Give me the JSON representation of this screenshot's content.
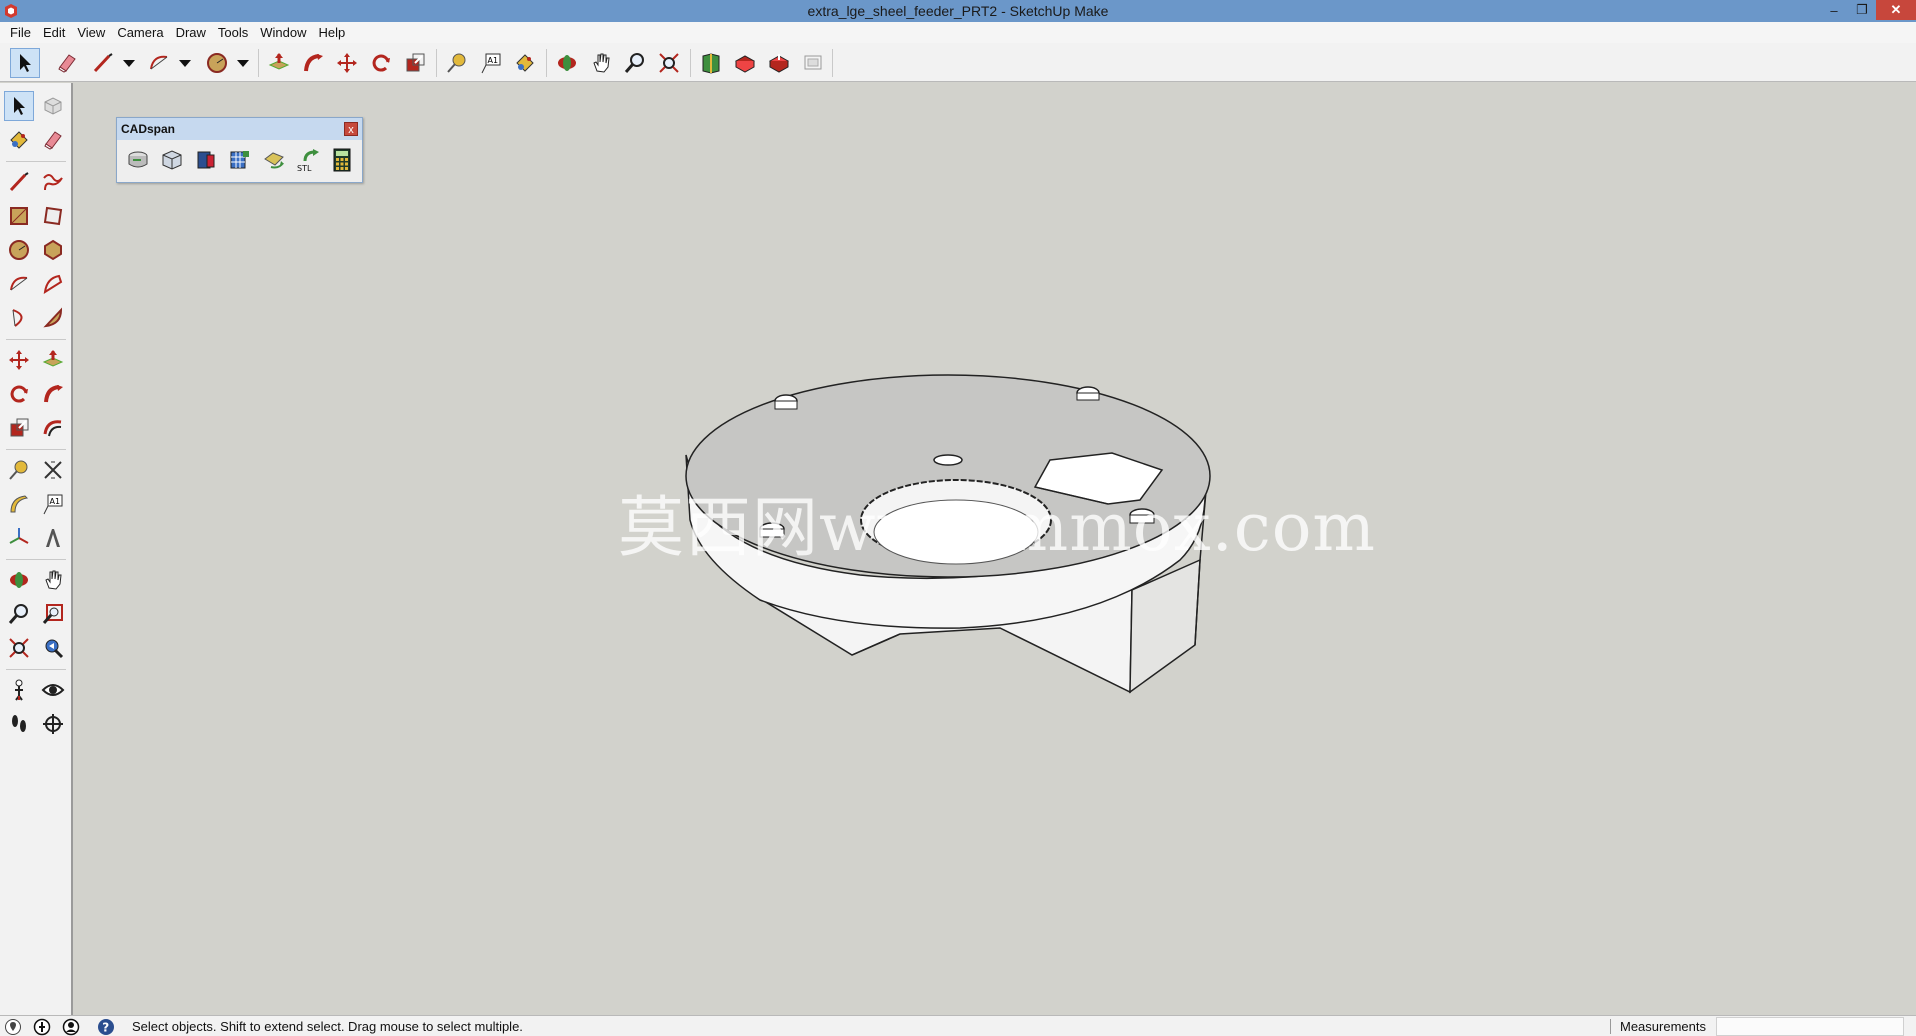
{
  "window": {
    "title": "extra_lge_sheel_feeder_PRT2 - SketchUp Make",
    "minimize_glyph": "–",
    "restore_glyph": "❐",
    "close_glyph": "✕"
  },
  "menu": {
    "items": [
      {
        "label": "File"
      },
      {
        "label": "Edit"
      },
      {
        "label": "View"
      },
      {
        "label": "Camera"
      },
      {
        "label": "Draw"
      },
      {
        "label": "Tools"
      },
      {
        "label": "Window"
      },
      {
        "label": "Help"
      }
    ]
  },
  "top_toolbar": {
    "tools": [
      "select-icon",
      "eraser-icon",
      "line-icon",
      "arc-icon",
      "circle-icon",
      "push-pull-icon",
      "follow-me-icon",
      "move-icon",
      "rotate-icon",
      "scale-icon",
      "tape-measure-icon",
      "text-icon",
      "paint-bucket-icon",
      "orbit-icon",
      "pan-icon",
      "zoom-icon",
      "zoom-extents-icon",
      "3d-warehouse-icon",
      "extension-warehouse-icon",
      "share-model-icon",
      "layout-icon"
    ],
    "active": "select-icon"
  },
  "left_toolbar": {
    "tools": [
      "select-icon",
      "make-component-icon",
      "paint-bucket-icon",
      "eraser-icon",
      "line-icon",
      "freehand-icon",
      "rectangle-icon",
      "rotated-rectangle-icon",
      "circle-icon",
      "polygon-icon",
      "arc-icon",
      "two-point-arc-icon",
      "three-point-arc-icon",
      "pie-icon",
      "move-icon",
      "push-pull-icon",
      "rotate-icon",
      "follow-me-icon",
      "scale-icon",
      "offset-icon",
      "tape-measure-icon",
      "dimension-icon",
      "protractor-icon",
      "text-icon",
      "axes-icon",
      "3d-text-icon",
      "orbit-icon",
      "pan-icon",
      "zoom-icon",
      "zoom-window-icon",
      "zoom-extents-icon",
      "previous-view-icon",
      "position-camera-icon",
      "look-around-icon",
      "walk-icon",
      "section-plane-icon"
    ],
    "active": "select-icon"
  },
  "cadspan": {
    "title": "CADspan",
    "close_glyph": "x",
    "tools": [
      "cadspan-import-icon",
      "cadspan-resurface-icon",
      "cadspan-export-icon",
      "cadspan-grid-icon",
      "cadspan-repair-icon",
      "cadspan-stl-export-icon",
      "cadspan-calculator-icon"
    ],
    "stl_label": "STL"
  },
  "watermark": {
    "text": "莫西网www.mmox.com"
  },
  "statusbar": {
    "icons": [
      "geo-location-icon",
      "credits-icon",
      "user-icon",
      "instructor-help-icon"
    ],
    "message": "Select objects. Shift to extend select. Drag mouse to select multiple.",
    "measurements_label": "Measurements",
    "measurements_value": ""
  },
  "colors": {
    "titlebar": "#6b97c9",
    "viewport_background": "#d2d2cc",
    "model_top": "#c6c6c4",
    "model_side": "#f2f2f2",
    "close_button": "#c7473c"
  }
}
